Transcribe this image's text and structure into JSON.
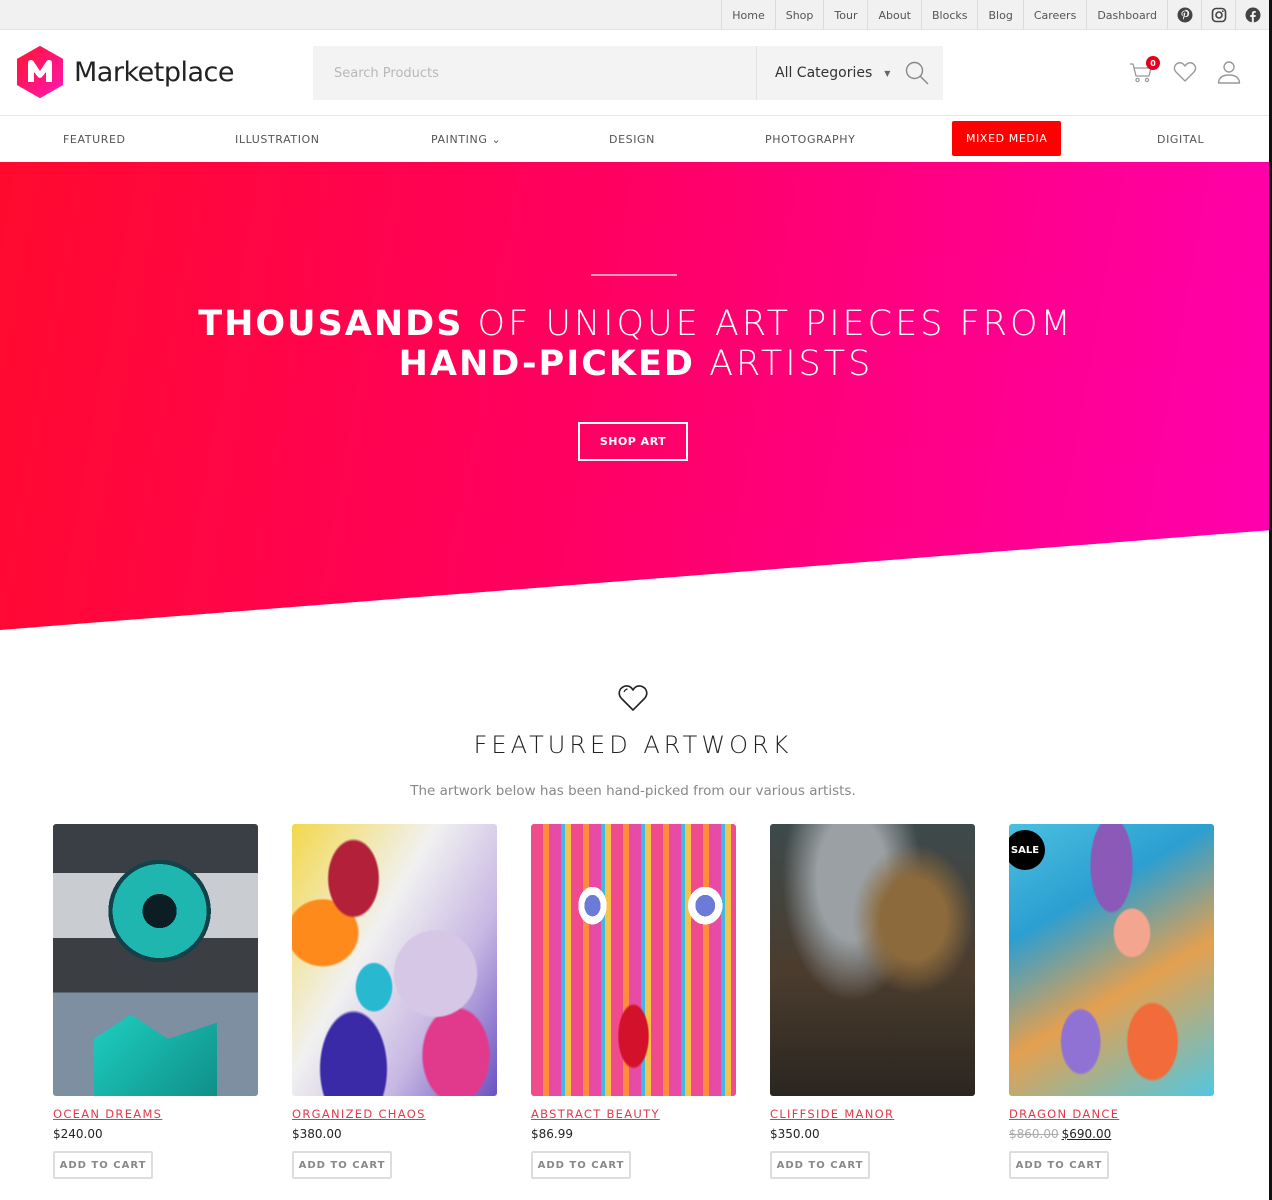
{
  "topbar": {
    "links": [
      "Home",
      "Shop",
      "Tour",
      "About",
      "Blocks",
      "Blog",
      "Careers",
      "Dashboard"
    ],
    "social": [
      "pinterest-icon",
      "instagram-icon",
      "facebook-icon"
    ]
  },
  "header": {
    "logo_text": "Marketplace",
    "search_placeholder": "Search Products",
    "search_value": "",
    "category_selected": "All Categories",
    "cart_count": "0"
  },
  "nav": {
    "items": [
      "Featured",
      "Illustration",
      "Painting ⌄",
      "Design",
      "Photography",
      "Mixed Media",
      "Digital"
    ],
    "active_index": 5
  },
  "hero": {
    "line1_bold": "THOUSANDS",
    "line1_rest": " OF UNIQUE ART PIECES FROM",
    "line2_bold": "HAND-PICKED",
    "line2_rest": " ARTISTS",
    "button": "SHOP ART",
    "gradient_start": "#ff0a2e",
    "gradient_end": "#ff00b0"
  },
  "featured": {
    "title": "FEATURED ARTWORK",
    "subtitle": "The artwork below has been hand-picked from our various artists."
  },
  "products": [
    {
      "title": "Ocean Dreams",
      "price": "$240.00",
      "old_price": "",
      "sale": false,
      "button": "ADD TO CART"
    },
    {
      "title": "Organized Chaos",
      "price": "$380.00",
      "old_price": "",
      "sale": false,
      "button": "ADD TO CART"
    },
    {
      "title": "Abstract Beauty",
      "price": "$86.99",
      "old_price": "",
      "sale": false,
      "button": "ADD TO CART"
    },
    {
      "title": "Cliffside Manor",
      "price": "$350.00",
      "old_price": "",
      "sale": false,
      "button": "ADD TO CART"
    },
    {
      "title": "Dragon Dance",
      "price": "$690.00",
      "old_price": "$860.00",
      "sale": true,
      "sale_label": "SALE",
      "button": "ADD TO CART"
    }
  ],
  "colors": {
    "accent": "#ff0000",
    "product_title": "#e03a4d",
    "badge": "#e3001b"
  }
}
